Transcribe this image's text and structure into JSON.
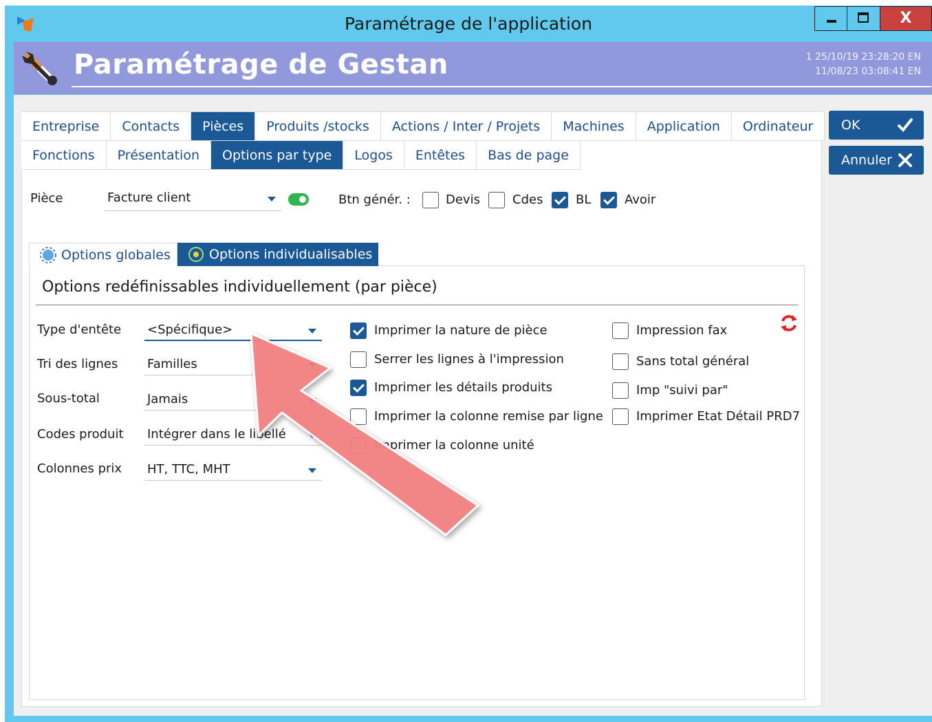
{
  "window": {
    "title": "Paramétrage de l'application",
    "close_label": "X"
  },
  "header": {
    "title": "Paramétrage de Gestan",
    "info_line1": "1  25/10/19 23:28:20  EN",
    "info_line2": "11/08/23 03:08:41  EN"
  },
  "tabs_row1": [
    "Entreprise",
    "Contacts",
    "Pièces",
    "Produits /stocks",
    "Actions / Inter / Projets",
    "Machines",
    "Application",
    "Ordinateur"
  ],
  "tabs_row2": [
    "Fonctions",
    "Présentation",
    "Options par type",
    "Logos",
    "Entêtes",
    "Bas de page"
  ],
  "active_tab_row1": "Pièces",
  "active_tab_row2": "Options par type",
  "buttons": {
    "ok": "OK",
    "cancel": "Annuler"
  },
  "piece": {
    "label": "Pièce",
    "value": "Facture client",
    "btn_gener_label": "Btn génér. :",
    "checks": [
      {
        "label": "Devis",
        "checked": false
      },
      {
        "label": "Cdes",
        "checked": false
      },
      {
        "label": "BL",
        "checked": true
      },
      {
        "label": "Avoir",
        "checked": true
      }
    ]
  },
  "inner_tabs": {
    "globals": "Options globales",
    "indiv": "Options individualisables"
  },
  "section": {
    "title": "Options redéfinissables individuellement (par pièce)"
  },
  "fields": [
    {
      "label": "Type d'entête",
      "value": "<Spécifique>"
    },
    {
      "label": "Tri des lignes",
      "value": "Familles"
    },
    {
      "label": "Sous-total",
      "value": "Jamais"
    },
    {
      "label": "Codes produit",
      "value": "Intégrer dans le libellé"
    },
    {
      "label": "Colonnes prix",
      "value": "HT, TTC, MHT"
    }
  ],
  "options_col1": [
    {
      "label": "Imprimer la nature de pièce",
      "checked": true
    },
    {
      "label": "Serrer les lignes à l'impression",
      "checked": false
    },
    {
      "label": "Imprimer les détails produits",
      "checked": true
    },
    {
      "label": "Imprimer la colonne remise par ligne",
      "checked": false
    },
    {
      "label": "Imprimer la colonne unité",
      "checked": false
    }
  ],
  "options_col2": [
    {
      "label": "Impression fax",
      "checked": false
    },
    {
      "label": "Sans total général",
      "checked": false
    },
    {
      "label": "Imp \"suivi par\"",
      "checked": false
    },
    {
      "label": "Imprimer Etat Détail PRD7",
      "checked": false
    }
  ],
  "colors": {
    "titlebar": "#62c9ee",
    "header": "#9198dc",
    "accent": "#1a5896",
    "annotation_arrow": "#f47f7f"
  },
  "icons": {
    "app": "app-logo-icon",
    "tools": "tools-icon",
    "refresh": "refresh-icon"
  }
}
